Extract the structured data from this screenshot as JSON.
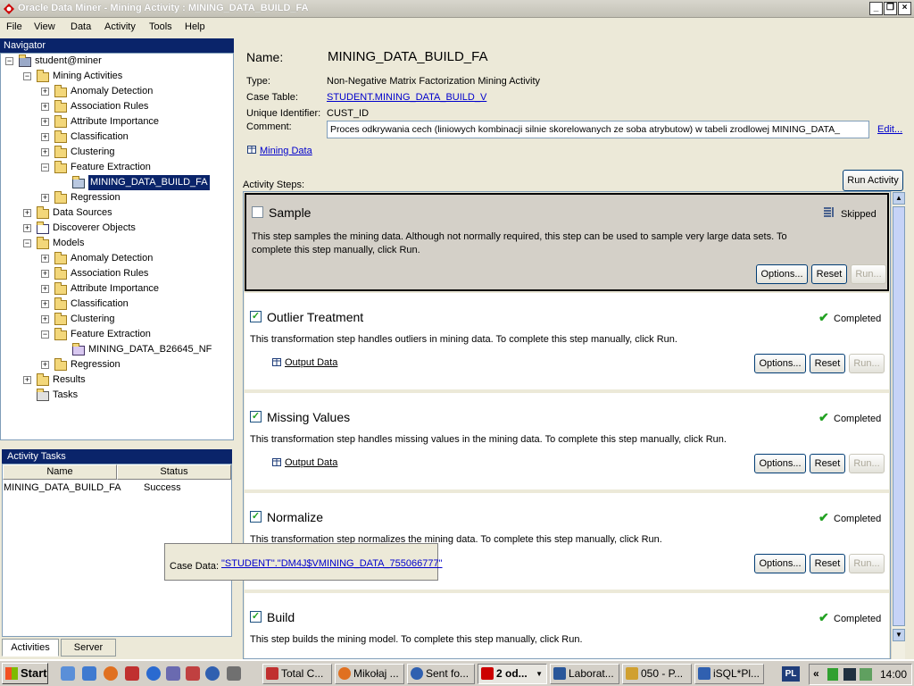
{
  "window": {
    "title": "Oracle Data Miner - Mining Activity : MINING_DATA_BUILD_FA"
  },
  "menu": [
    "File",
    "View",
    "Data",
    "Activity",
    "Tools",
    "Help"
  ],
  "navigator": {
    "title": "Navigator",
    "root": "student@miner",
    "mining_activities": "Mining Activities",
    "ma_children": [
      "Anomaly Detection",
      "Association Rules",
      "Attribute Importance",
      "Classification",
      "Clustering",
      "Feature Extraction"
    ],
    "ma_selected": "MINING_DATA_BUILD_FA",
    "ma_regression": "Regression",
    "data_sources": "Data Sources",
    "discoverer": "Discoverer Objects",
    "models": "Models",
    "models_children": [
      "Anomaly Detection",
      "Association Rules",
      "Attribute Importance",
      "Classification",
      "Clustering",
      "Feature Extraction"
    ],
    "model_item": "MINING_DATA_B26645_NF",
    "models_regression": "Regression",
    "results": "Results",
    "tasks": "Tasks"
  },
  "activity_tasks": {
    "title": "Activity Tasks",
    "col_name": "Name",
    "col_status": "Status",
    "rows": [
      {
        "name": "MINING_DATA_BUILD_FA",
        "status": "Success"
      }
    ]
  },
  "bottom_tabs": [
    "Activities",
    "Server"
  ],
  "details": {
    "name_label": "Name:",
    "name": "MINING_DATA_BUILD_FA",
    "type_label": "Type:",
    "type": "Non-Negative Matrix Factorization Mining Activity",
    "case_label": "Case Table:",
    "case_table": "STUDENT.MINING_DATA_BUILD_V",
    "uid_label": "Unique Identifier:",
    "uid": "CUST_ID",
    "comment_label": "Comment:",
    "comment": "Proces odkrywania cech (liniowych kombinacji silnie skorelowanych ze soba atrybutow) w tabeli zrodlowej MINING_DATA_",
    "edit": "Edit...",
    "mining_data": "Mining Data",
    "steps_label": "Activity Steps:",
    "run_activity": "Run Activity"
  },
  "buttons": {
    "options": "Options...",
    "reset": "Reset",
    "run": "Run..."
  },
  "steps": [
    {
      "name": "Sample",
      "status": "Skipped",
      "desc": "This step samples the mining data. Although not normally required, this step can be used to sample very large data sets. To complete this step manually, click Run.",
      "output": ""
    },
    {
      "name": "Outlier Treatment",
      "status": "Completed",
      "desc": "This transformation step handles outliers in mining data. To complete this step manually, click Run.",
      "output": "Output Data"
    },
    {
      "name": "Missing Values",
      "status": "Completed",
      "desc": "This transformation step handles missing values in the mining data. To complete this step manually, click Run.",
      "output": "Output Data"
    },
    {
      "name": "Normalize",
      "status": "Completed",
      "desc": "This transformation step normalizes the mining data. To complete this step manually, click Run.",
      "output": ""
    },
    {
      "name": "Build",
      "status": "Completed",
      "desc": "This step builds the mining model. To complete this step manually, click Run.",
      "output": ""
    }
  ],
  "tooltip": {
    "label": "Case Data:",
    "value": "\"STUDENT\".\"DM4J$VMINING_DATA_755066777\""
  },
  "taskbar": {
    "start": "Start",
    "items": [
      "Total C...",
      "Mikołaj ...",
      "Sent fo...",
      "2 od...",
      "Laborat...",
      "050 - P...",
      "iSQL*Pl..."
    ],
    "lang": "PL",
    "clock": "14:00"
  }
}
